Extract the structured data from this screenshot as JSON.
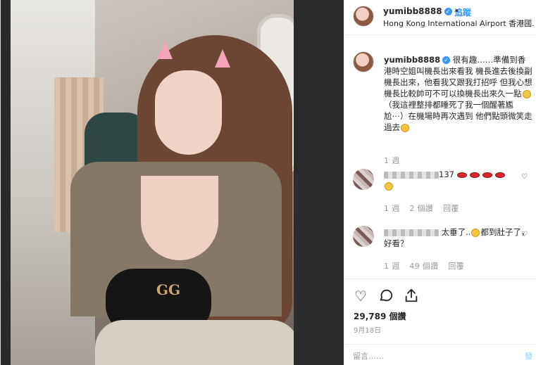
{
  "header": {
    "username": "yumibb8888",
    "follow_label": "追蹤",
    "location": "Hong Kong International Airport 香港國..."
  },
  "caption": {
    "username": "yumibb8888",
    "text": "很有趣……準備到香港時空姐叫機長出來看我 機長進去後換副機長出來，他看我又跟我打招呼 但我心想機長比較帥可不可以換機長出來久一點",
    "text2": "（我這裡整排都睡死了我一個醒著尷尬⋯）在機場時再次遇到 他們點頭微笑走過去",
    "time": "1 週"
  },
  "comments": [
    {
      "suffix": "137",
      "second_line_emoji": "grin",
      "time": "1 週",
      "likes": "2 個讚",
      "reply": "回覆"
    },
    {
      "text_a": "太垂了..",
      "text_b": "都到肚子了，好看？",
      "time": "1 週",
      "likes": "49 個讚",
      "reply": "回覆"
    }
  ],
  "stats": {
    "likes": "29,789 個讚",
    "date": "9月18日"
  },
  "add_comment": {
    "placeholder": "留言……",
    "post_label": "發"
  },
  "photo": {
    "bag_logo": "GG"
  },
  "icons": [
    "verified-badge-icon",
    "heart-icon",
    "comment-icon",
    "share-icon",
    "heart-small-icon"
  ],
  "colors": {
    "accent": "#3897f0",
    "text": "#262626",
    "muted": "#999999"
  }
}
